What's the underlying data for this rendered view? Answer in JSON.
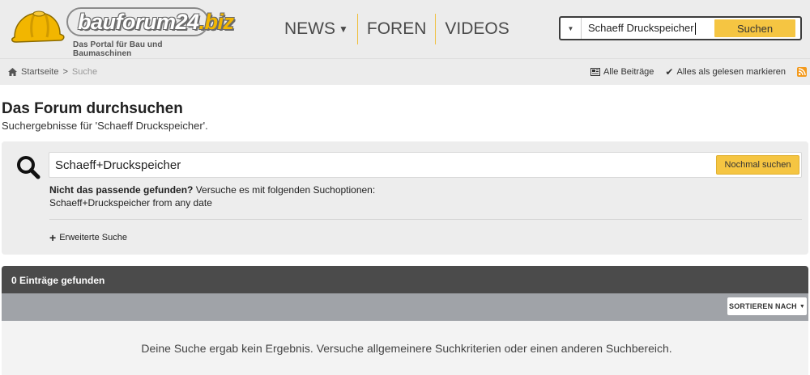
{
  "header": {
    "logo_main": "bauforum24",
    "logo_tld": ".biz",
    "logo_tagline": "Das Portal für Bau und Baumaschinen",
    "nav": [
      {
        "label": "NEWS",
        "has_dropdown": true
      },
      {
        "label": "FOREN",
        "has_dropdown": false
      },
      {
        "label": "VIDEOS",
        "has_dropdown": false
      }
    ],
    "search": {
      "value": "Schaeff Druckspeicher",
      "button_label": "Suchen"
    },
    "accent_color": "#f5c542"
  },
  "breadcrumb": {
    "home": "Startseite",
    "separator": ">",
    "current": "Suche"
  },
  "actions": {
    "all_posts": "Alle Beiträge",
    "mark_read": "Alles als gelesen markieren"
  },
  "page": {
    "title": "Das Forum durchsuchen",
    "subtitle": "Suchergebnisse für 'Schaeff Druckspeicher'."
  },
  "search_panel": {
    "query": "Schaeff+Druckspeicher",
    "button_label": "Nochmal suchen",
    "hint_bold": "Nicht das passende gefunden?",
    "hint_rest": " Versuche es mit folgenden Suchoptionen:",
    "suggestion": "Schaeff+Druckspeicher from any date",
    "advanced_label": "Erweiterte Suche"
  },
  "results": {
    "count_label": "0 Einträge gefunden",
    "sort_label": "SORTIEREN NACH",
    "empty_message": "Deine Suche ergab kein Ergebnis. Versuche allgemeinere Suchkriterien oder einen anderen Suchbereich."
  }
}
